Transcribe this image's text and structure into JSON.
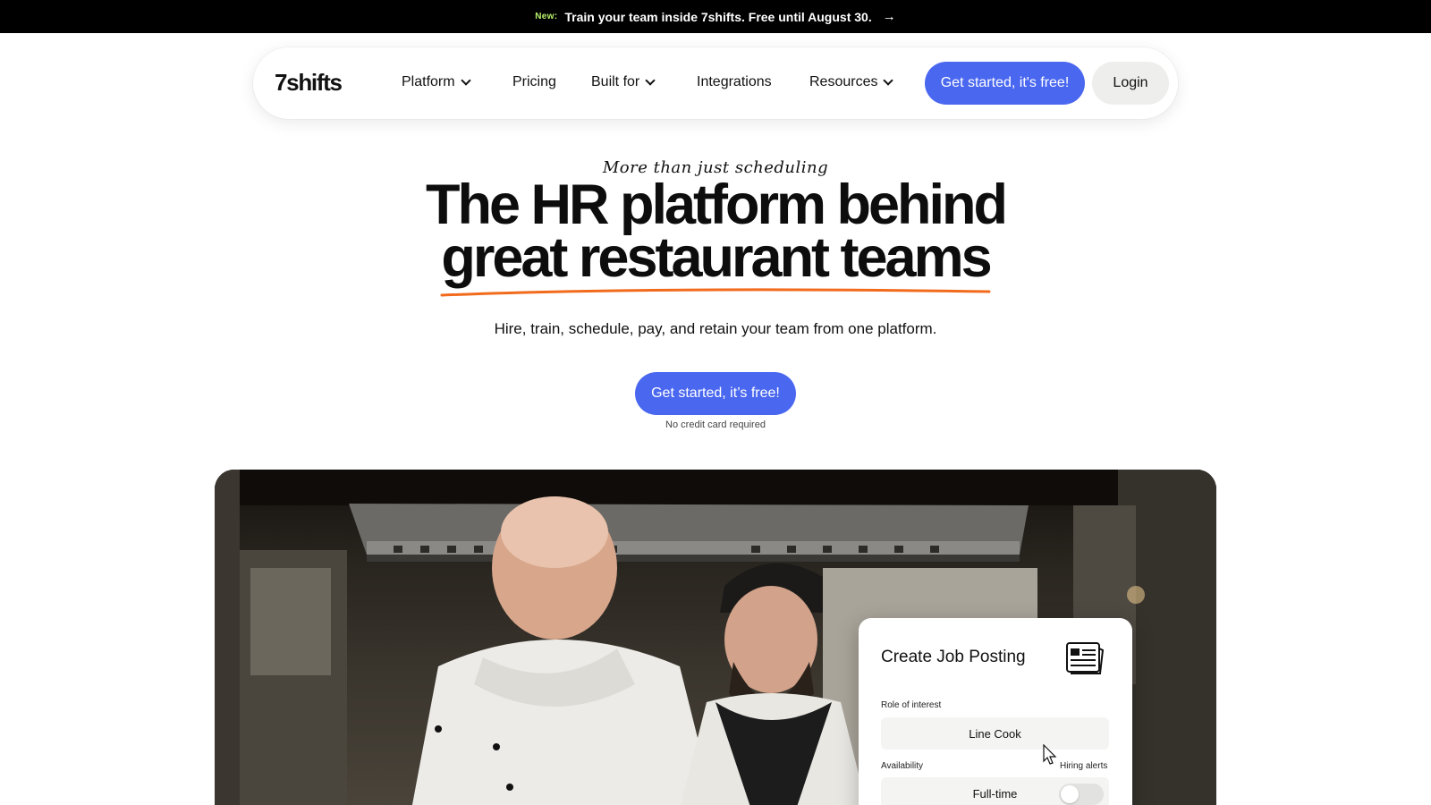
{
  "announcement": {
    "tag": "New:",
    "message": "Train your team inside 7shifts. Free until August 30.",
    "arrow": "→"
  },
  "nav": {
    "logo": "7shifts",
    "items": [
      {
        "label": "Platform",
        "dropdown": true
      },
      {
        "label": "Pricing",
        "dropdown": false
      },
      {
        "label": "Built for",
        "dropdown": true
      },
      {
        "label": "Integrations",
        "dropdown": false
      },
      {
        "label": "Resources",
        "dropdown": true
      }
    ],
    "cta_label": "Get started, it's free!",
    "login_label": "Login"
  },
  "hero": {
    "eyebrow": "More than just scheduling",
    "headline_line1": "The HR platform behind",
    "headline_line2": "great restaurant teams",
    "subtitle": "Hire, train, schedule, pay, and retain your team from one platform.",
    "cta_label": "Get started, it’s free!",
    "note": "No credit card required"
  },
  "job_card": {
    "title": "Create Job Posting",
    "role_label": "Role of interest",
    "role_value": "Line Cook",
    "availability_label": "Availability",
    "availability_value": "Full-time",
    "alerts_label": "Hiring alerts"
  },
  "colors": {
    "brand_blue": "#4a67f0",
    "underline_orange": "#f26b1d",
    "new_tag_green": "#b8f36b"
  }
}
